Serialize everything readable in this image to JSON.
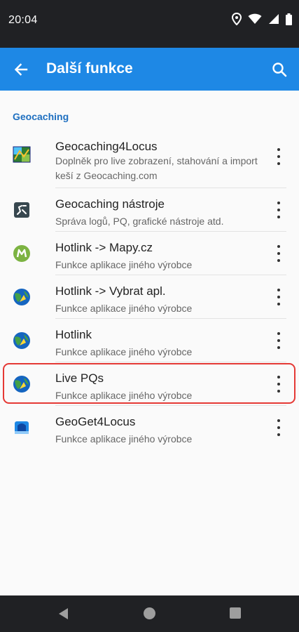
{
  "status_bar": {
    "time": "20:04",
    "icons": [
      "location-icon",
      "wifi-icon",
      "signal-icon",
      "battery-icon"
    ]
  },
  "app_bar": {
    "title": "Další funkce",
    "back_icon": "arrow-back-icon",
    "search_icon": "search-icon",
    "color": "#1e88e5"
  },
  "section": {
    "header": "Geocaching",
    "header_color": "#1e6fc0"
  },
  "items": [
    {
      "title": "Geocaching4Locus",
      "subtitle": "Doplněk pro live zobrazení, stahování a import keší z Geocaching.com",
      "icon": "geocaching4locus-icon"
    },
    {
      "title": "Geocaching nástroje",
      "subtitle": "Správa logů, PQ, grafické nástroje atd.",
      "icon": "geocaching-tools-icon"
    },
    {
      "title": "Hotlink -> Mapy.cz",
      "subtitle": "Funkce aplikace jiného výrobce",
      "icon": "mapy-cz-icon"
    },
    {
      "title": "Hotlink -> Vybrat apl.",
      "subtitle": "Funkce aplikace jiného výrobce",
      "icon": "globe-icon"
    },
    {
      "title": "Hotlink",
      "subtitle": "Funkce aplikace jiného výrobce",
      "icon": "globe-icon"
    },
    {
      "title": "Live PQs",
      "subtitle": "Funkce aplikace jiného výrobce",
      "icon": "globe-icon",
      "highlighted": true,
      "highlight_color": "#e53935"
    },
    {
      "title": "GeoGet4Locus",
      "subtitle": "Funkce aplikace jiného výrobce",
      "icon": "geoget-icon"
    }
  ],
  "nav_bar": {
    "icons": [
      "nav-back-icon",
      "nav-home-icon",
      "nav-recents-icon"
    ]
  }
}
